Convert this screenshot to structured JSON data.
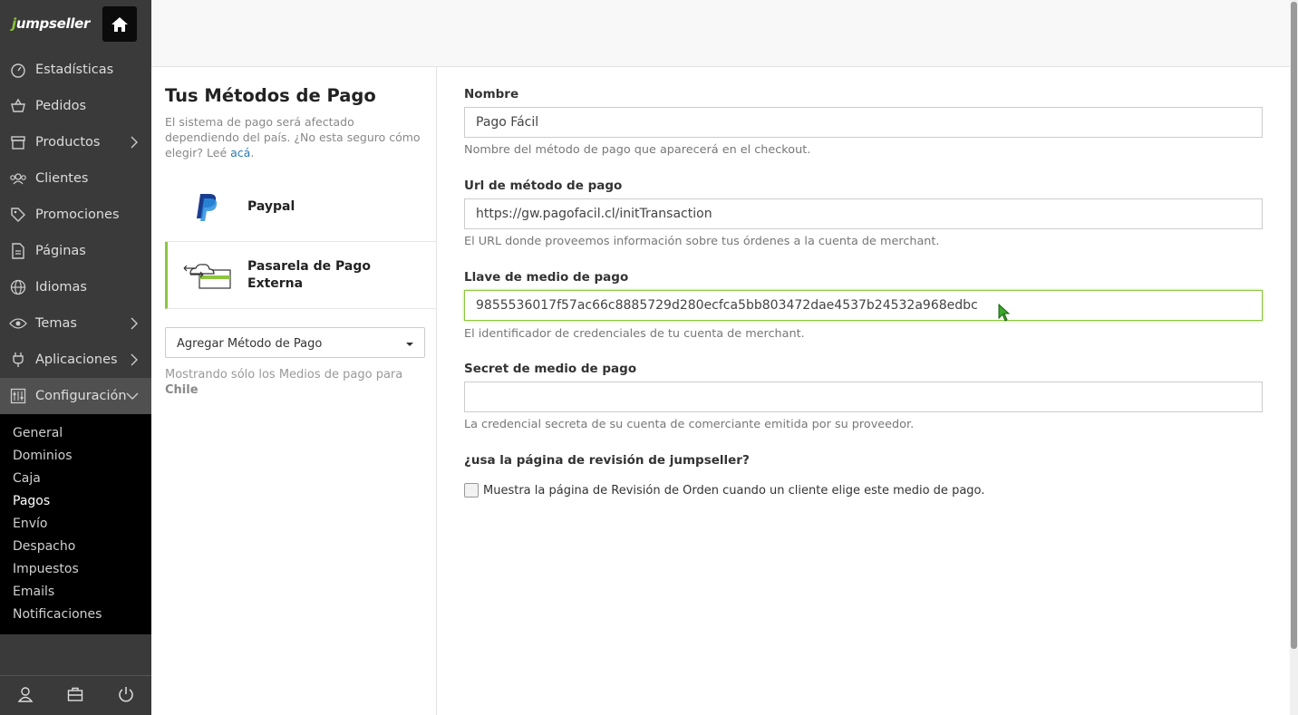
{
  "brand": {
    "logo_text": "jumpseller"
  },
  "sidebar": {
    "items": [
      {
        "label": "Estadísticas",
        "icon": "dashboard-icon"
      },
      {
        "label": "Pedidos",
        "icon": "basket-icon"
      },
      {
        "label": "Productos",
        "icon": "box-icon"
      },
      {
        "label": "Clientes",
        "icon": "users-icon"
      },
      {
        "label": "Promociones",
        "icon": "tags-icon"
      },
      {
        "label": "Páginas",
        "icon": "page-icon"
      },
      {
        "label": "Idiomas",
        "icon": "globe-icon"
      },
      {
        "label": "Temas",
        "icon": "eye-icon"
      },
      {
        "label": "Aplicaciones",
        "icon": "plug-icon"
      },
      {
        "label": "Configuración",
        "icon": "settings-icon"
      }
    ],
    "sub_items": [
      "General",
      "Dominios",
      "Caja",
      "Pagos",
      "Envío",
      "Despacho",
      "Impuestos",
      "Emails",
      "Notificaciones"
    ],
    "active_sub": "Pagos"
  },
  "left_panel": {
    "title": "Tus Métodos de Pago",
    "desc_text": "El sistema de pago será afectado dependiendo del país. ¿No esta seguro cómo elegir? Leé ",
    "desc_link": "acá",
    "desc_end": ".",
    "methods": [
      {
        "label": "Paypal",
        "icon": "paypal-icon"
      },
      {
        "label": "Pasarela de Pago Externa",
        "icon": "external-gateway-icon"
      }
    ],
    "add_select_label": "Agregar Método de Pago",
    "note_text": "Mostrando sólo los Medios de pago para",
    "note_country": "Chile"
  },
  "form": {
    "name_label": "Nombre",
    "name_value": "Pago Fácil",
    "name_help": "Nombre del método de pago que aparecerá en el checkout.",
    "url_label": "Url de método de pago",
    "url_value": "https://gw.pagofacil.cl/initTransaction",
    "url_help": "El URL donde proveemos información sobre tus órdenes a la cuenta de merchant.",
    "key_label": "Llave de medio de pago",
    "key_value": "9855536017f57ac66c8885729d280ecfca5bb803472dae4537b24532a968edbc",
    "key_help": "El identificador de credenciales de tu cuenta de merchant.",
    "secret_label": "Secret de medio de pago",
    "secret_value": "",
    "secret_help": "La credencial secreta de su cuenta de comerciante emitida por su proveedor.",
    "review_label": "¿usa la página de revisión de jumpseller?",
    "review_checkbox_text": "Muestra la página de Revisión de Orden cuando un cliente elige este medio de pago."
  },
  "colors": {
    "accent": "#8cc63f",
    "sidebar_bg": "#3a3a3a",
    "submenu_bg": "#000000"
  }
}
